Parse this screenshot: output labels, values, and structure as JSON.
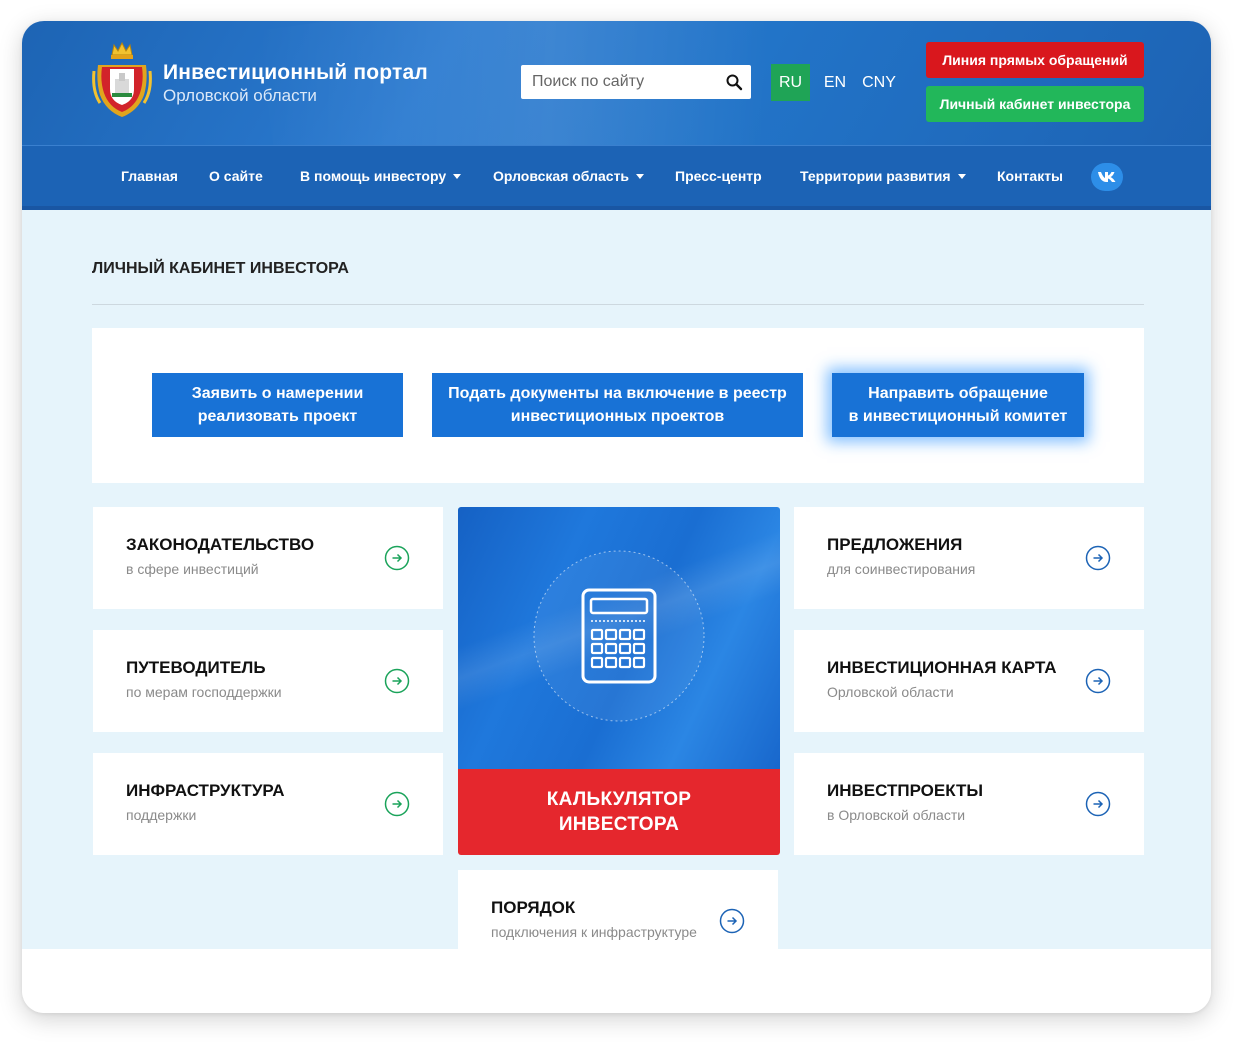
{
  "header": {
    "title": "Инвестиционный портал",
    "subtitle": "Орловской области",
    "search_placeholder": "Поиск по сайту",
    "languages": [
      "RU",
      "EN",
      "CNY"
    ],
    "active_language": "RU",
    "hotline_label": "Линия прямых обращений",
    "cabinet_label": "Личный кабинет инвестора"
  },
  "nav": {
    "items": [
      {
        "label": "Главная"
      },
      {
        "label": "О сайте"
      },
      {
        "label": "В помощь инвестору"
      },
      {
        "label": "Орловская область"
      },
      {
        "label": "Пресс-центр"
      },
      {
        "label": "Территории развития"
      },
      {
        "label": "Контакты"
      }
    ]
  },
  "page": {
    "title": "ЛИЧНЫЙ КАБИНЕТ ИНВЕСТОРА"
  },
  "actions": [
    {
      "line1": "Заявить о намерении",
      "line2": "реализовать проект"
    },
    {
      "line1": "Подать документы на включение в реестр",
      "line2": "инвестиционных проектов"
    },
    {
      "line1": "Направить обращение",
      "line2": "в инвестиционный комитет"
    }
  ],
  "cards": [
    {
      "title": "ЗАКОНОДАТЕЛЬСТВО",
      "subtitle": "в сфере инвестиций"
    },
    {
      "title": "ПУТЕВОДИТЕЛЬ",
      "subtitle": "по мерам господдержки"
    },
    {
      "title": "ИНФРАСТРУКТУРА",
      "subtitle": "поддержки"
    },
    {
      "title": "ПРЕДЛОЖЕНИЯ",
      "subtitle": "для соинвестирования"
    },
    {
      "title": "ИНВЕСТИЦИОННАЯ КАРТА",
      "subtitle": "Орловской области"
    },
    {
      "title": "ИНВЕСТПРОЕКТЫ",
      "subtitle": "в Орловской области"
    },
    {
      "title": "ПОРЯДОК",
      "subtitle": "подключения к инфраструктуре"
    }
  ],
  "calculator": {
    "line1": "КАЛЬКУЛЯТОР",
    "line2": "ИНВЕСТОРА"
  },
  "colors": {
    "header_blue": "#1d64b4",
    "action_blue": "#1872d6",
    "hotline_red": "#d9171d",
    "cabinet_green": "#22b75a",
    "calc_red": "#e5272d",
    "arrow_green": "#1aa35a",
    "arrow_blue": "#1c63b5"
  }
}
